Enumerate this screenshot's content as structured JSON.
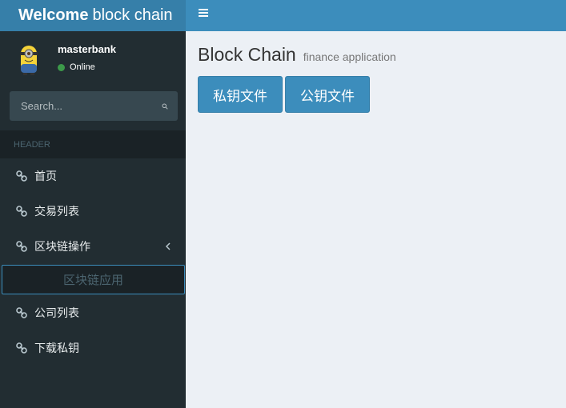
{
  "brand": {
    "bold": "Welcome",
    "thin": "block chain"
  },
  "user": {
    "name": "masterbank",
    "status": "Online"
  },
  "search": {
    "placeholder": "Search..."
  },
  "sidebar": {
    "header": "HEADER",
    "items": [
      {
        "label": "首页"
      },
      {
        "label": "交易列表"
      },
      {
        "label": "区块链操作"
      },
      {
        "label": "公司列表"
      },
      {
        "label": "下载私钥"
      }
    ],
    "subitem": "区块链应用"
  },
  "topbar": {
    "menu_icon": "hamburger-icon"
  },
  "page": {
    "title": "Block Chain",
    "subtitle": "finance application"
  },
  "buttons": {
    "private_key": "私钥文件",
    "public_key": "公钥文件"
  },
  "colors": {
    "primary": "#3c8dbc",
    "sidebar": "#222d32",
    "background": "#ecf0f5"
  }
}
